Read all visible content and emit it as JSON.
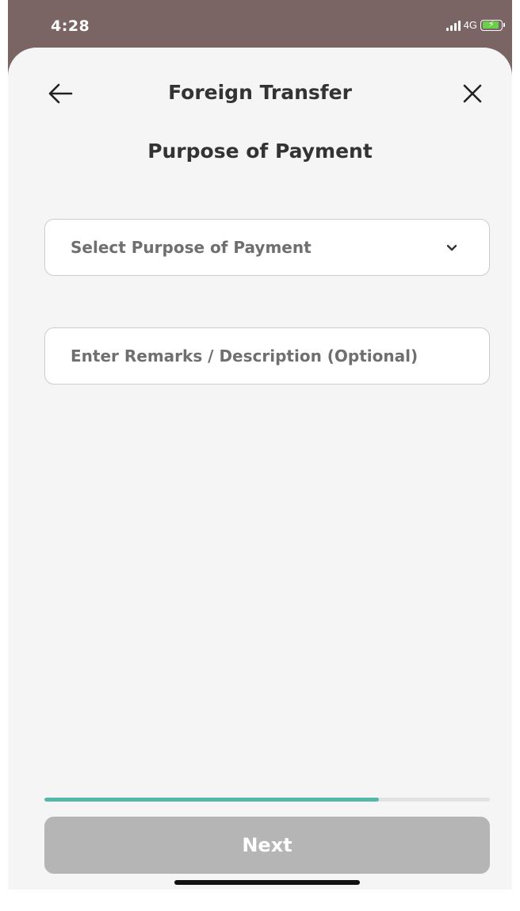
{
  "status_bar": {
    "time": "4:28",
    "network": "4G",
    "icons": [
      "signal-icon",
      "battery-charging-icon"
    ],
    "battery_color": "#6ad04a"
  },
  "header": {
    "title": "Foreign Transfer",
    "back_icon": "arrow-left-icon",
    "close_icon": "close-icon"
  },
  "page": {
    "title": "Purpose of Payment"
  },
  "form": {
    "purpose_select": {
      "selected_value": "Select Purpose of Payment",
      "icon": "chevron-down-icon"
    },
    "remarks": {
      "value": "",
      "placeholder": "Enter Remarks / Description (Optional)"
    }
  },
  "progress": {
    "fraction": 0.75,
    "color": "#56b7a8"
  },
  "footer": {
    "next_label": "Next",
    "next_enabled": false
  },
  "colors": {
    "status_bar_bg": "#7b6464",
    "sheet_bg": "#f5f5f5",
    "disabled_button": "#b5b5b5"
  }
}
